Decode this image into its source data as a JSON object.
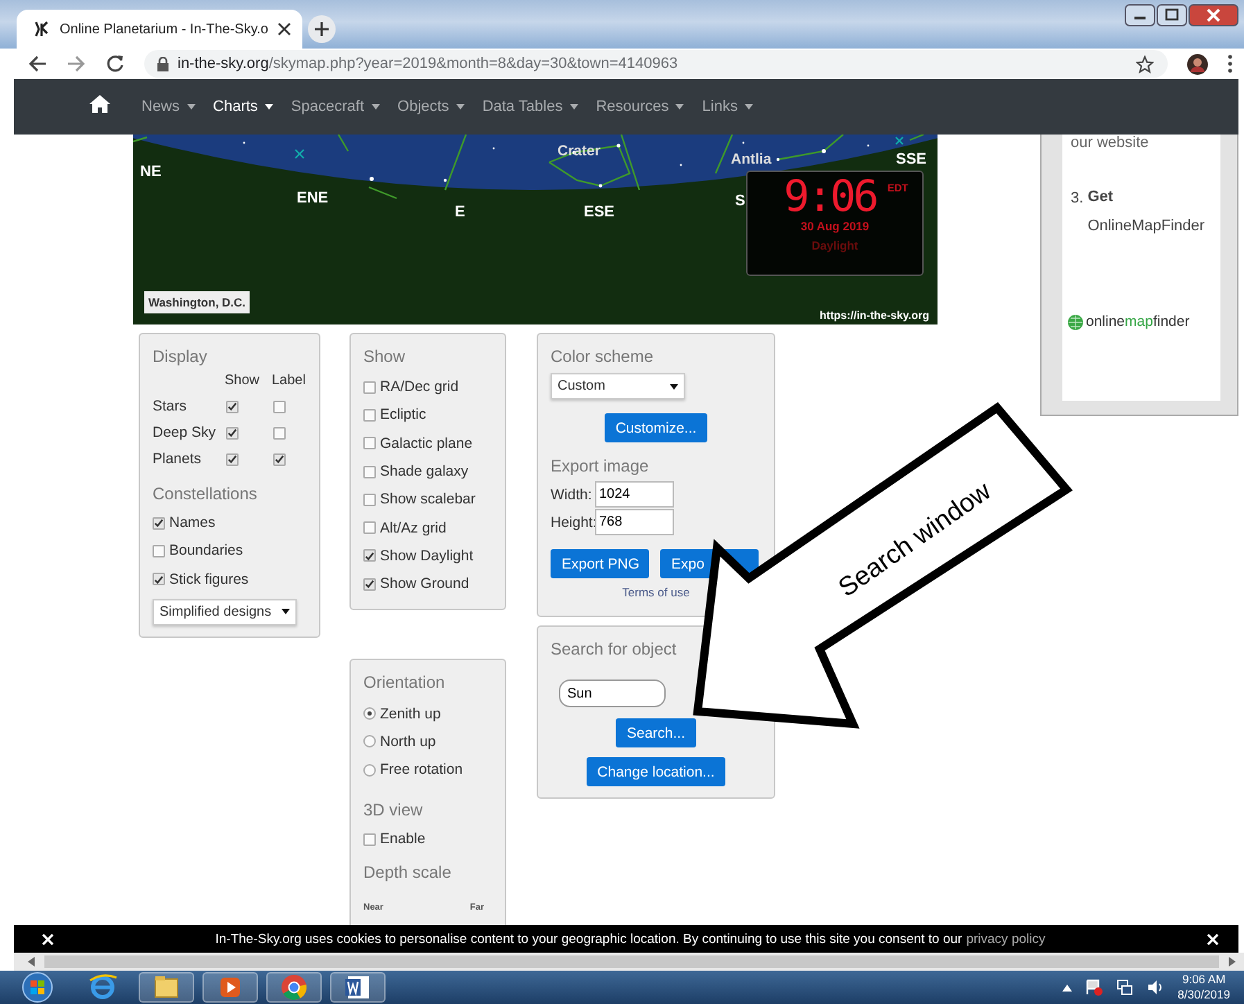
{
  "browser": {
    "tab_title": "Online Planetarium - In-The-Sky.o",
    "url_host": "in-the-sky.org",
    "url_path": "/skymap.php?year=2019&month=8&day=30&town=4140963"
  },
  "nav": {
    "items": [
      {
        "label": "News",
        "selected": false
      },
      {
        "label": "Charts",
        "selected": true
      },
      {
        "label": "Spacecraft",
        "selected": false
      },
      {
        "label": "Objects",
        "selected": false
      },
      {
        "label": "Data Tables",
        "selected": false
      },
      {
        "label": "Resources",
        "selected": false
      },
      {
        "label": "Links",
        "selected": false
      }
    ]
  },
  "sky_map": {
    "labels": [
      {
        "text": "NE",
        "kind": "direction"
      },
      {
        "text": "ENE",
        "kind": "direction"
      },
      {
        "text": "E",
        "kind": "direction"
      },
      {
        "text": "ESE",
        "kind": "direction"
      },
      {
        "text": "S",
        "kind": "direction"
      },
      {
        "text": "SSE",
        "kind": "direction"
      },
      {
        "text": "Crater",
        "kind": "constellation"
      },
      {
        "text": "Antlia",
        "kind": "constellation"
      }
    ],
    "clock": {
      "time": "9:06",
      "zone": "EDT",
      "date": "30 Aug 2019",
      "mode": "Daylight"
    },
    "location": "Washington, D.C.",
    "credit": "https://in-the-sky.org"
  },
  "display_panel": {
    "title": "Display",
    "columns": [
      "Show",
      "Label"
    ],
    "rows": [
      {
        "name": "Stars",
        "show": true,
        "label": false
      },
      {
        "name": "Deep Sky",
        "show": true,
        "label": false
      },
      {
        "name": "Planets",
        "show": true,
        "label": true
      }
    ]
  },
  "constellations_panel": {
    "title": "Constellations",
    "options": [
      {
        "label": "Names",
        "checked": true
      },
      {
        "label": "Boundaries",
        "checked": false
      },
      {
        "label": "Stick figures",
        "checked": true
      }
    ],
    "style": "Simplified designs"
  },
  "show_panel": {
    "title": "Show",
    "options": [
      {
        "label": "RA/Dec grid",
        "checked": false
      },
      {
        "label": "Ecliptic",
        "checked": false
      },
      {
        "label": "Galactic plane",
        "checked": false
      },
      {
        "label": "Shade galaxy",
        "checked": false
      },
      {
        "label": "Show scalebar",
        "checked": false
      },
      {
        "label": "Alt/Az grid",
        "checked": false
      },
      {
        "label": "Show Daylight",
        "checked": true
      },
      {
        "label": "Show Ground",
        "checked": true
      }
    ]
  },
  "color_panel": {
    "title": "Color scheme",
    "scheme": "Custom",
    "customize": "Customize...",
    "export_title": "Export image",
    "fields": [
      {
        "label": "Width:",
        "value": "1024"
      },
      {
        "label": "Height:",
        "value": "768"
      }
    ],
    "buttons": [
      "Export PNG",
      "Expo"
    ],
    "terms": "Terms of use"
  },
  "orientation_panel": {
    "title": "Orientation",
    "options": [
      {
        "label": "Zenith up",
        "selected": true
      },
      {
        "label": "North up",
        "selected": false
      },
      {
        "label": "Free rotation",
        "selected": false
      }
    ],
    "view_title": "3D view",
    "enable": {
      "label": "Enable",
      "checked": false
    },
    "depth_title": "Depth scale",
    "near": "Near",
    "far": "Far"
  },
  "search_panel": {
    "title": "Search for object",
    "query": "Sun",
    "search_button": "Search...",
    "location_button": "Change location..."
  },
  "ad": {
    "top_text": "our website",
    "step_number": "3.",
    "step_text": "**Get** OnlineMapFinder",
    "logo_parts": [
      {
        "text": "online",
        "kind": "plain"
      },
      {
        "text": "map",
        "kind": "accent"
      },
      {
        "text": "finder",
        "kind": "plain"
      }
    ]
  },
  "annotation": {
    "text": "Search window"
  },
  "cookie_bar": {
    "text": "In-The-Sky.org uses cookies to personalise content to your geographic location. By continuing to use this site you consent to our",
    "link": "privacy policy"
  },
  "taskbar": {
    "time": "9:06 AM",
    "date": "8/30/2019"
  }
}
